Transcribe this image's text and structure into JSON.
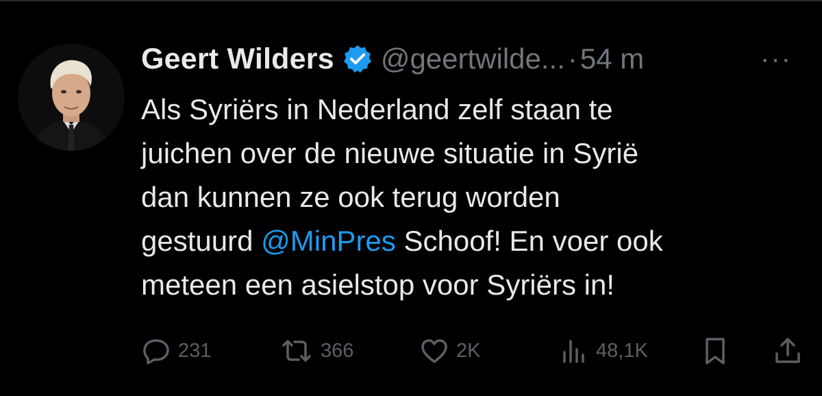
{
  "tweet": {
    "author": {
      "display_name": "Geert Wilders",
      "verified": true,
      "handle": "@geertwilde...",
      "separator": "·",
      "time_ago": "54 m",
      "avatar_icon": "profile-photo"
    },
    "more_label": "···",
    "text": {
      "line1": "Als Syriërs in Nederland zelf staan te",
      "line2": "juichen over de nieuwe situatie in Syrië",
      "line3": "dan kunnen ze ook terug worden",
      "line4_pre": "gestuurd ",
      "mention": "@MinPres",
      "line4_post": " Schoof! En voer ook",
      "line5": "meteen een asielstop voor Syriërs in!"
    },
    "actions": {
      "replies": "231",
      "reposts": "366",
      "likes": "2K",
      "views": "48,1K"
    }
  },
  "colors": {
    "background": "#000000",
    "text": "#e7e9ea",
    "secondary": "#71767b",
    "mention": "#1d9bf0",
    "verified_badge": "#1d9bf0"
  }
}
